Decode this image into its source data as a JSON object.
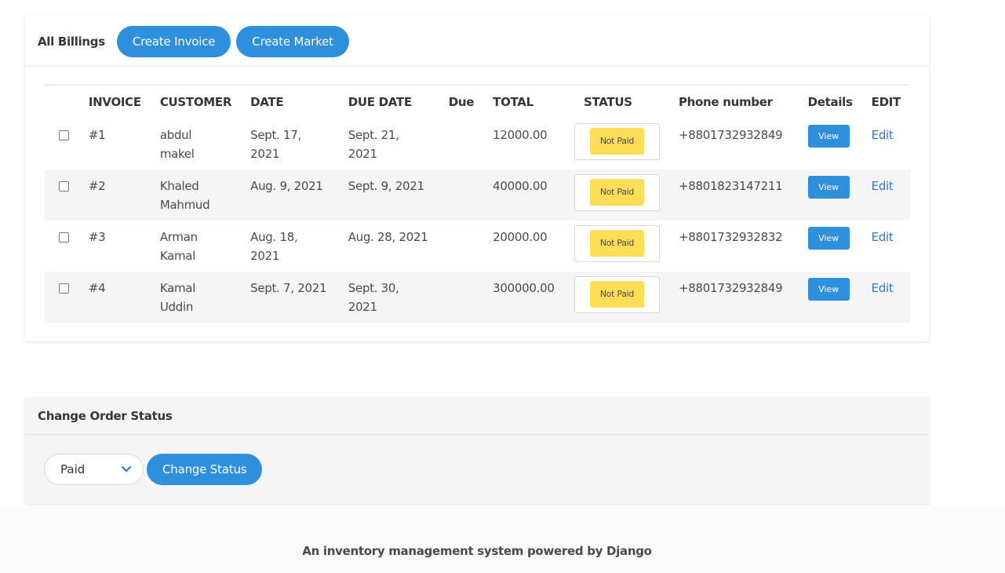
{
  "billing": {
    "title": "All Billings",
    "create_invoice_label": "Create Invoice",
    "create_market_label": "Create Market",
    "columns": {
      "invoice": "INVOICE",
      "customer": "CUSTOMER",
      "date": "DATE",
      "due_date": "DUE DATE",
      "due": "Due",
      "total": "TOTAL",
      "status": "STATUS",
      "phone": "Phone number",
      "details": "Details",
      "edit": "EDIT"
    },
    "rows": [
      {
        "invoice": "#1",
        "customer_first": "abdul",
        "customer_last": "makel",
        "date": "Sept. 17, 2021",
        "due_date": "Sept. 21, 2021",
        "due": "",
        "total": "12000.00",
        "status": "Not Paid",
        "phone": "+8801732932849",
        "view": "View",
        "edit": "Edit"
      },
      {
        "invoice": "#2",
        "customer_first": "Khaled",
        "customer_last": "Mahmud",
        "date": "Aug. 9, 2021",
        "due_date": "Sept. 9, 2021",
        "due": "",
        "total": "40000.00",
        "status": "Not Paid",
        "phone": "+8801823147211",
        "view": "View",
        "edit": "Edit"
      },
      {
        "invoice": "#3",
        "customer_first": "Arman",
        "customer_last": "Kamal",
        "date": "Aug. 18, 2021",
        "due_date": "Aug. 28, 2021",
        "due": "",
        "total": "20000.00",
        "status": "Not Paid",
        "phone": "+8801732932832",
        "view": "View",
        "edit": "Edit"
      },
      {
        "invoice": "#4",
        "customer_first": "Kamal",
        "customer_last": "Uddin",
        "date": "Sept. 7, 2021",
        "due_date": "Sept. 30, 2021",
        "due": "",
        "total": "300000.00",
        "status": "Not Paid",
        "phone": "+8801732932849",
        "view": "View",
        "edit": "Edit"
      }
    ]
  },
  "order_status": {
    "title": "Change Order Status",
    "selected": "Paid",
    "change_label": "Change Status"
  },
  "footer": {
    "text": "An inventory management system powered by Django"
  },
  "colors": {
    "primary": "#2e8fdc",
    "warning": "#ffdd57",
    "link": "#3273dc"
  },
  "icons": {
    "select_arrow": "chevron-down-icon"
  }
}
